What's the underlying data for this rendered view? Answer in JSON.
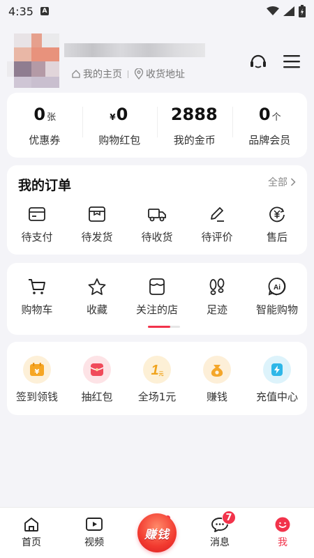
{
  "status": {
    "time": "4:35",
    "sim_label": "A"
  },
  "profile": {
    "home_link": "我的主页",
    "address_link": "收货地址",
    "icons": [
      "headset-icon",
      "menu-icon"
    ]
  },
  "stats": [
    {
      "value": "0",
      "unit": "张",
      "prefix": "",
      "label": "优惠券"
    },
    {
      "value": "0",
      "unit": "",
      "prefix": "¥",
      "label": "购物红包"
    },
    {
      "value": "2888",
      "unit": "",
      "prefix": "",
      "label": "我的金币"
    },
    {
      "value": "0",
      "unit": "个",
      "prefix": "",
      "label": "品牌会员"
    }
  ],
  "orders": {
    "title": "我的订单",
    "all_label": "全部",
    "items": [
      {
        "label": "待支付",
        "icon": "wallet-icon"
      },
      {
        "label": "待发货",
        "icon": "package-icon"
      },
      {
        "label": "待收货",
        "icon": "truck-icon"
      },
      {
        "label": "待评价",
        "icon": "pen-icon"
      },
      {
        "label": "售后",
        "icon": "yuan-refund-icon"
      }
    ]
  },
  "tools": [
    {
      "label": "购物车",
      "icon": "cart-icon"
    },
    {
      "label": "收藏",
      "icon": "star-icon"
    },
    {
      "label": "关注的店",
      "icon": "store-icon"
    },
    {
      "label": "足迹",
      "icon": "footprint-icon"
    },
    {
      "label": "智能购物",
      "icon": "ai-icon"
    }
  ],
  "promos": [
    {
      "label": "签到领钱",
      "icon": "calendar-yuan-icon",
      "glyph": "¥",
      "color": "#f6a623",
      "bg": "#fdf0d8"
    },
    {
      "label": "抽红包",
      "icon": "red-envelope-icon",
      "glyph": "",
      "color": "#f04a5a",
      "bg": "#fde3e6"
    },
    {
      "label": "全场1元",
      "icon": "one-yuan-icon",
      "glyph": "1",
      "color": "#f0a31c",
      "bg": "#fdf0d6"
    },
    {
      "label": "赚钱",
      "icon": "money-bag-icon",
      "glyph": "",
      "color": "#f4a62a",
      "bg": "#fdefd8"
    },
    {
      "label": "充值中心",
      "icon": "lightning-icon",
      "glyph": "",
      "color": "#2eb7e8",
      "bg": "#ddf3fb"
    }
  ],
  "tabbar": {
    "items": [
      {
        "label": "首页",
        "icon": "home-icon"
      },
      {
        "label": "视频",
        "icon": "video-icon"
      },
      {
        "label": "",
        "icon": "earn-money-icon",
        "center_text": "赚钱"
      },
      {
        "label": "消息",
        "icon": "message-icon",
        "badge": "7"
      },
      {
        "label": "我",
        "icon": "me-icon"
      }
    ]
  },
  "colors": {
    "accent": "#f2334b",
    "background": "#f4f4f8",
    "card": "#ffffff"
  }
}
